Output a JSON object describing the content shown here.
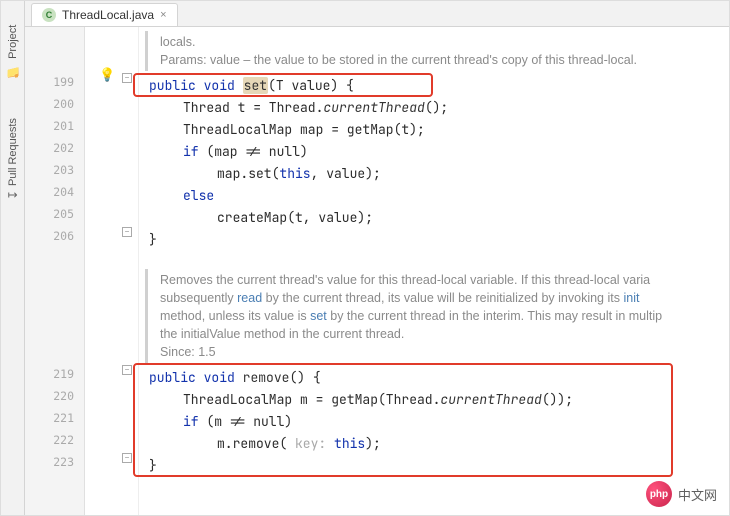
{
  "sidebar": {
    "project": {
      "label": "Project",
      "icon": "📁"
    },
    "pull": {
      "label": "Pull Requests",
      "icon": "↧"
    }
  },
  "tab": {
    "filename": "ThreadLocal.java",
    "icon_letter": "C",
    "close": "×"
  },
  "gutter_lines_block1": [
    "199",
    "200",
    "201",
    "202",
    "203",
    "204",
    "205",
    "206"
  ],
  "gutter_lines_block2": [
    "219",
    "220",
    "221",
    "222",
    "223"
  ],
  "doc1": {
    "tail": "locals.",
    "params_label": "Params:",
    "params_text": " value – the value to be stored in the current thread's copy of this thread-local."
  },
  "code1": {
    "l1": {
      "kw1": "public",
      "kw2": "void",
      "name": "set",
      "sig": "(T value) {"
    },
    "l2": {
      "a": "Thread t = Thread.",
      "b": "currentThread",
      "c": "();"
    },
    "l3": "ThreadLocalMap map = getMap(t);",
    "l4": {
      "kw": "if",
      "rest": " (map != null)"
    },
    "l5": {
      "a": "map.set(",
      "kw": "this",
      "b": ", value);"
    },
    "l6": {
      "kw": "else"
    },
    "l7": "createMap(t, value);",
    "l8": "}"
  },
  "doc2": {
    "line1a": "Removes the current thread's value for this thread-local variable. If this thread-local varia",
    "line2a": "subsequently ",
    "read": "read",
    "line2b": " by the current thread, its value will be reinitialized by invoking its ",
    "init": "init",
    "line3a": "method, unless its value is ",
    "set": "set",
    "line3b": " by the current thread in the interim. This may result in multip",
    "line4": "the initialValue method in the current thread.",
    "since_label": "Since:",
    "since_val": " 1.5"
  },
  "code2": {
    "l1": {
      "kw1": "public",
      "kw2": "void",
      "name": "remove",
      "sig": "() {"
    },
    "l2": {
      "a": "ThreadLocalMap m = getMap(Thread.",
      "b": "currentThread",
      "c": "());"
    },
    "l3": {
      "kw": "if",
      "rest": " (m != null)"
    },
    "l4": {
      "a": "m.remove(",
      "hint": " key: ",
      "kw": "this",
      "b": ");"
    },
    "l5": "}"
  },
  "watermark": {
    "logo": "php",
    "text": "中文网"
  },
  "fold_glyph": "−"
}
